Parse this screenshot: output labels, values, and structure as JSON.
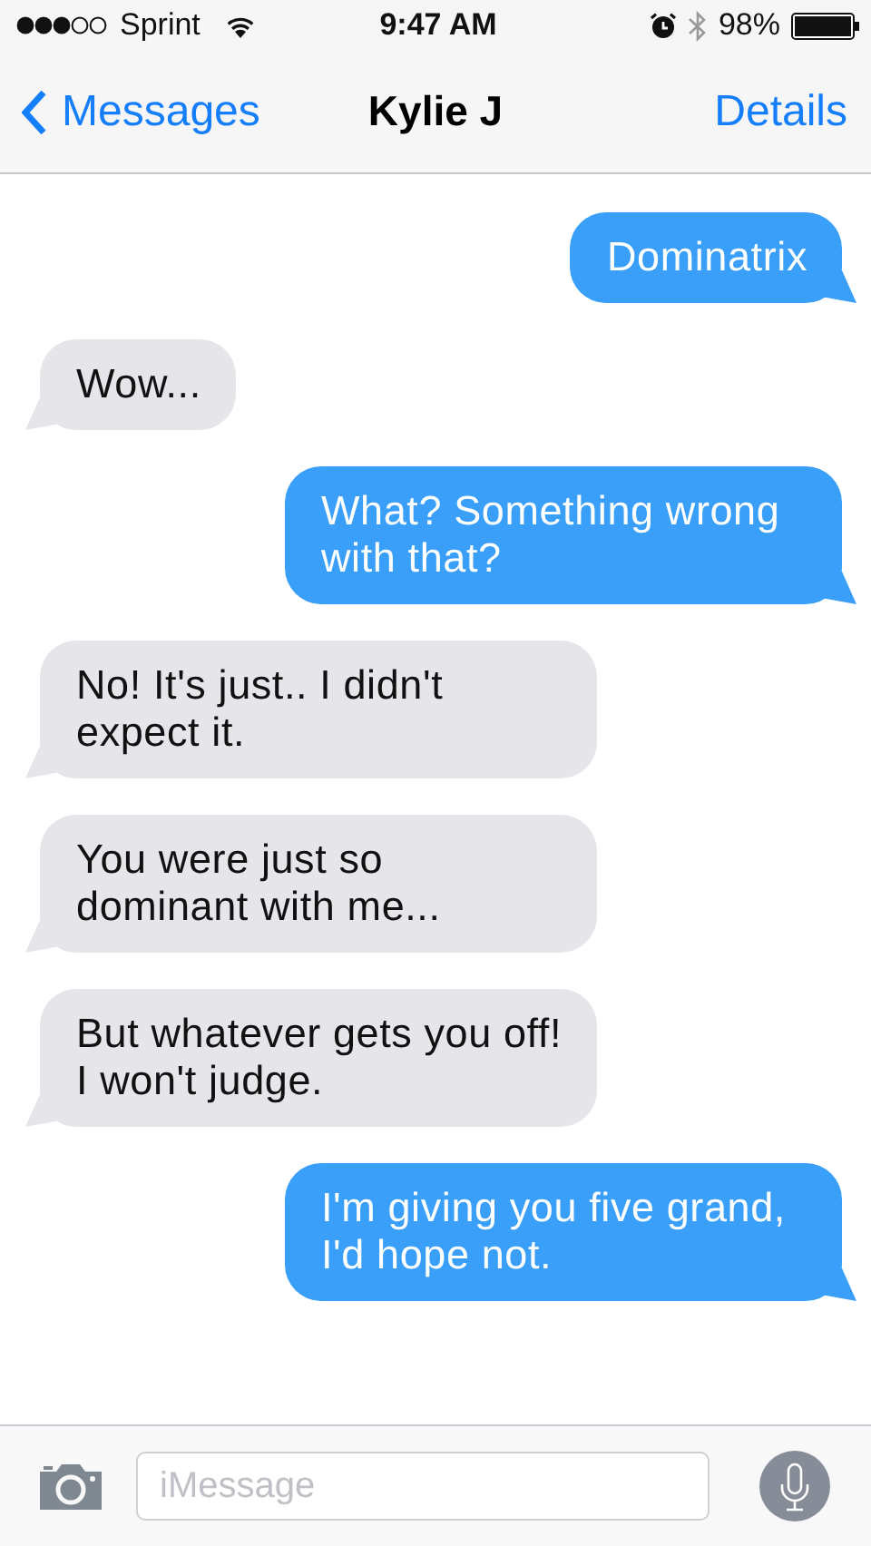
{
  "status_bar": {
    "carrier": "Sprint",
    "time": "9:47 AM",
    "battery": "98%"
  },
  "nav_bar": {
    "back": "Messages",
    "title": "Kylie J",
    "action": "Details"
  },
  "messages": [
    {
      "kind": "sent",
      "text": "Dominatrix"
    },
    {
      "kind": "received",
      "text": "Wow..."
    },
    {
      "kind": "sent",
      "text": "What? Something wrong with that?"
    },
    {
      "kind": "received",
      "text": "No! It's just.. I didn't expect it."
    },
    {
      "kind": "received",
      "text": "You were just so dominant with me..."
    },
    {
      "kind": "received",
      "text": "But whatever gets you off! I won't judge."
    },
    {
      "kind": "sent",
      "text": "I'm giving you five grand, I'd hope not."
    }
  ],
  "input_bar": {
    "placeholder": "iMessage"
  }
}
